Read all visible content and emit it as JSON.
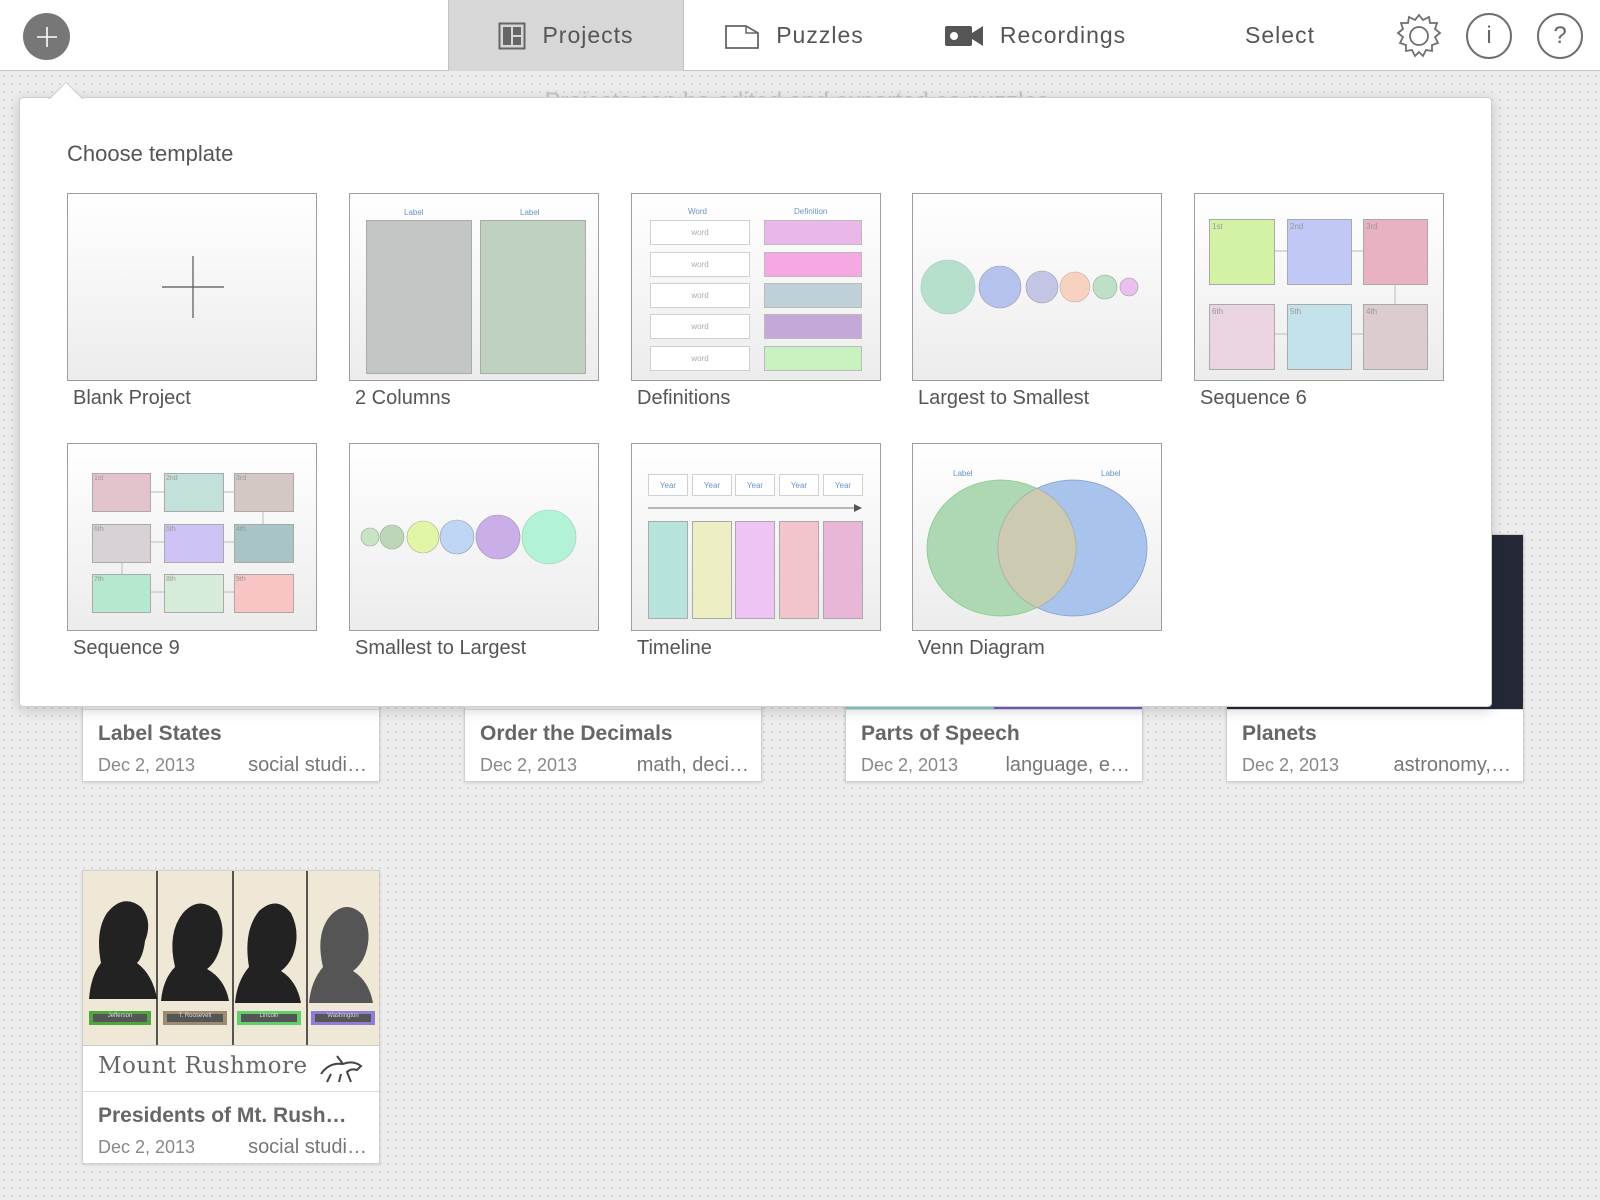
{
  "toolbar": {
    "tabs": {
      "projects": "Projects",
      "puzzles": "Puzzles",
      "recordings": "Recordings",
      "select": "Select"
    },
    "info_glyph": "i",
    "help_glyph": "?"
  },
  "hint": "Projects can be edited and exported as puzzles.",
  "popover": {
    "title": "Choose template",
    "templates": [
      {
        "label": "Blank Project",
        "icon": "plus-icon"
      },
      {
        "label": "2 Columns",
        "column_labels": [
          "Label",
          "Label"
        ]
      },
      {
        "label": "Definitions",
        "headers": [
          "Word",
          "Definition"
        ],
        "rows": [
          "word",
          "word",
          "word",
          "word",
          "word"
        ]
      },
      {
        "label": "Largest to Smallest"
      },
      {
        "label": "Sequence 6",
        "cells": [
          "1st",
          "2nd",
          "3rd",
          "6th",
          "5th",
          "4th"
        ]
      },
      {
        "label": "Sequence 9",
        "cells": [
          "1st",
          "2nd",
          "3rd",
          "6th",
          "5th",
          "4th",
          "7th",
          "8th",
          "9th"
        ]
      },
      {
        "label": "Smallest to Largest"
      },
      {
        "label": "Timeline",
        "headers": [
          "Year",
          "Year",
          "Year",
          "Year",
          "Year"
        ]
      },
      {
        "label": "Venn Diagram",
        "circle_labels": [
          "Label",
          "Label"
        ]
      }
    ]
  },
  "projects": [
    {
      "title": "Label States",
      "date": "Dec 2, 2013",
      "tags": "social studi…"
    },
    {
      "title": "Order the Decimals",
      "date": "Dec 2, 2013",
      "tags": "math, deci…"
    },
    {
      "title": "Parts of Speech",
      "date": "Dec 2, 2013",
      "tags": "language, e…"
    },
    {
      "title": "Planets",
      "date": "Dec 2, 2013",
      "tags": "astronomy,…"
    },
    {
      "title": "Presidents of Mt. Rush…",
      "date": "Dec 2, 2013",
      "tags": "social studi…",
      "banner": "Mount Rushmore",
      "name_tags": [
        "Jefferson",
        "T. Roosevelt",
        "Lincoln",
        "Washington"
      ]
    }
  ],
  "colors": {
    "accent_gray": "#777777",
    "active_tab": "#d7d7d7"
  }
}
